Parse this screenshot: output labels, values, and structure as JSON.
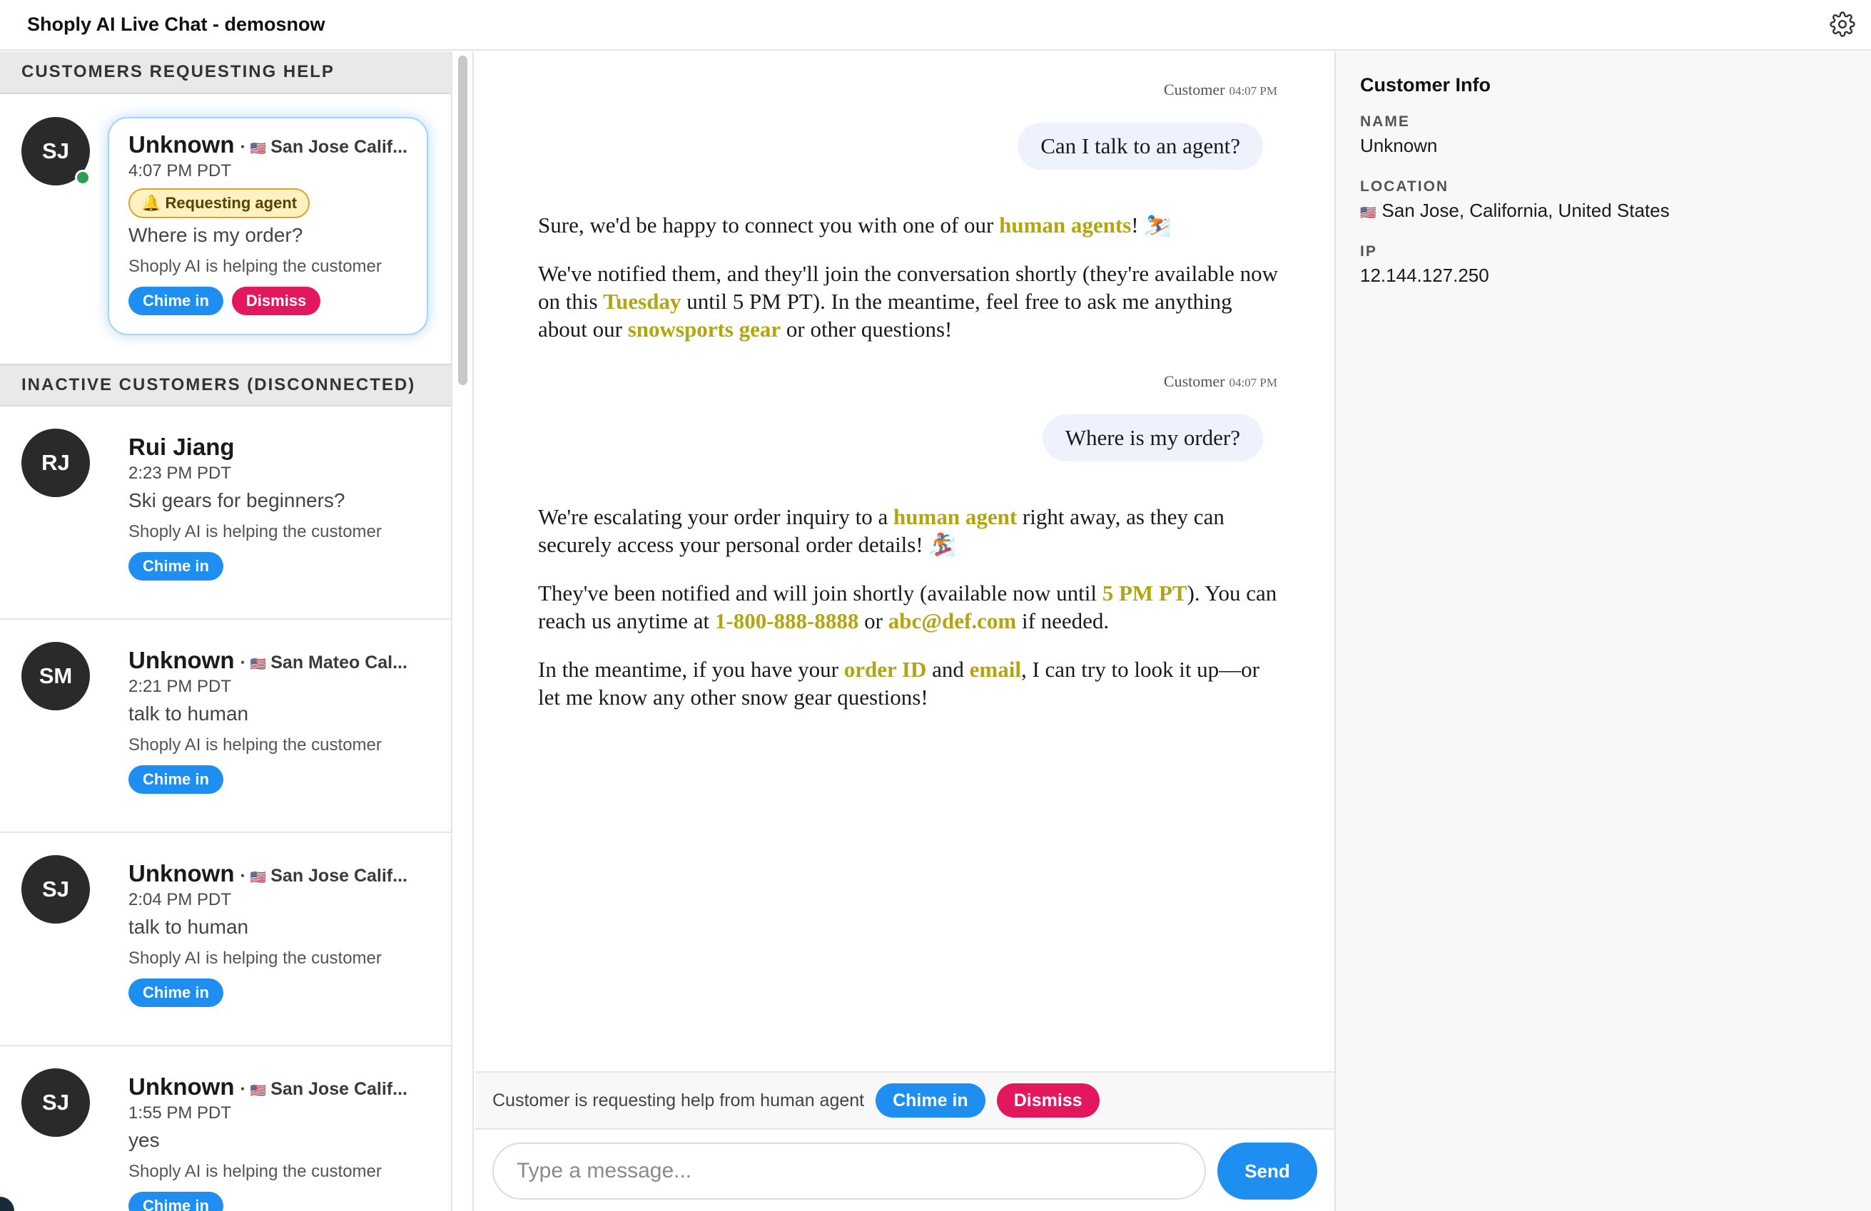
{
  "app": {
    "title": "Shoply AI Live Chat - demosnow"
  },
  "sidebar": {
    "section_active": "CUSTOMERS REQUESTING HELP",
    "section_inactive": "INACTIVE CUSTOMERS (DISCONNECTED)",
    "active_customer": {
      "initials": "SJ",
      "name": "Unknown",
      "separator": "·",
      "flag": "🇺🇸",
      "location": "San Jose Calif...",
      "time": "4:07 PM PDT",
      "badge": "🔔 Requesting agent",
      "last_message": "Where is my order?",
      "status": "Shoply AI is helping the customer",
      "chime_label": "Chime in",
      "dismiss_label": "Dismiss"
    },
    "inactive_customers": [
      {
        "initials": "RJ",
        "name": "Rui Jiang",
        "separator": "",
        "flag": "",
        "location": "",
        "time": "2:23 PM PDT",
        "last_message": "Ski gears for beginners?",
        "status": "Shoply AI is helping the customer",
        "chime_label": "Chime in"
      },
      {
        "initials": "SM",
        "name": "Unknown",
        "separator": "·",
        "flag": "🇺🇸",
        "location": "San Mateo Cal...",
        "time": "2:21 PM PDT",
        "last_message": "talk to human",
        "status": "Shoply AI is helping the customer",
        "chime_label": "Chime in"
      },
      {
        "initials": "SJ",
        "name": "Unknown",
        "separator": "·",
        "flag": "🇺🇸",
        "location": "San Jose Calif...",
        "time": "2:04 PM PDT",
        "last_message": "talk to human",
        "status": "Shoply AI is helping the customer",
        "chime_label": "Chime in"
      },
      {
        "initials": "SJ",
        "name": "Unknown",
        "separator": "·",
        "flag": "🇺🇸",
        "location": "San Jose Calif...",
        "time": "1:55 PM PDT",
        "last_message": "yes",
        "status": "Shoply AI is helping the customer",
        "chime_label": "Chime in"
      }
    ]
  },
  "chat": {
    "messages": [
      {
        "sender": "Customer",
        "time": "04:07 PM",
        "text": "Can I talk to an agent?"
      },
      {
        "sender": "Customer",
        "time": "04:07 PM",
        "text": "Where is my order?"
      }
    ],
    "ai1": {
      "p1_a": "Sure, we'd be happy to connect you with one of our ",
      "p1_hl": "human agents",
      "p1_b": "! ⛷️",
      "p2_a": "We've notified them, and they'll join the conversation shortly (they're available now on this ",
      "p2_hl1": "Tuesday",
      "p2_b": " until 5 PM PT). In the meantime, feel free to ask me anything about our ",
      "p2_hl2": "snowsports gear",
      "p2_c": " or other questions!"
    },
    "ai2": {
      "p1_a": "We're escalating your order inquiry to a ",
      "p1_hl": "human agent",
      "p1_b": " right away, as they can securely access your personal order details! 🏂",
      "p2_a": "They've been notified and will join shortly (available now until ",
      "p2_hl1": "5 PM PT",
      "p2_b": "). You can reach us anytime at ",
      "p2_hl2": "1-800-888-8888",
      "p2_c": " or ",
      "p2_hl3": "abc@def.com",
      "p2_d": " if needed.",
      "p3_a": "In the meantime, if you have your ",
      "p3_hl1": "order ID",
      "p3_b": " and ",
      "p3_hl2": "email",
      "p3_c": ", I can try to look it up—or let me know any other snow gear questions!"
    },
    "request_bar": {
      "text": "Customer is requesting help from human agent",
      "chime_label": "Chime in",
      "dismiss_label": "Dismiss"
    },
    "input": {
      "placeholder": "Type a message...",
      "value": ""
    },
    "send_label": "Send"
  },
  "info": {
    "title": "Customer Info",
    "name_label": "NAME",
    "name_value": "Unknown",
    "location_label": "LOCATION",
    "location_flag": "🇺🇸",
    "location_value": "San Jose, California, United States",
    "ip_label": "IP",
    "ip_value": "12.144.127.250"
  },
  "colors": {
    "accent_blue": "#1f8ef1",
    "dismiss_red": "#e2175e",
    "highlight": "#b2a50e",
    "online": "#2f9e55"
  }
}
